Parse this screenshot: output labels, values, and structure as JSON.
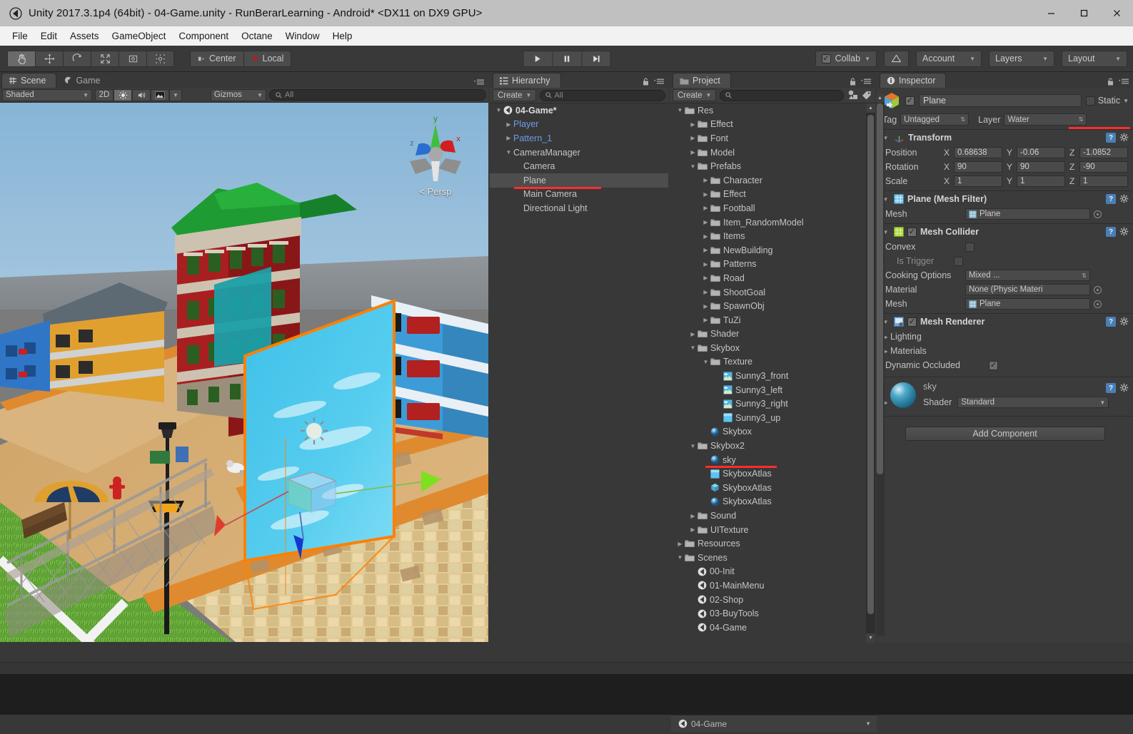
{
  "window": {
    "title": "Unity 2017.3.1p4 (64bit) - 04-Game.unity - RunBerarLearning - Android* <DX11 on DX9 GPU>",
    "app_icon": "unity-icon",
    "minimize_label": "—",
    "maximize_label": "□",
    "close_label": "✕"
  },
  "menubar": {
    "items": [
      "File",
      "Edit",
      "Assets",
      "GameObject",
      "Component",
      "Octane",
      "Window",
      "Help"
    ]
  },
  "toolbar": {
    "transform_tools": [
      {
        "name": "hand-tool",
        "glyph": "✋",
        "active": true
      },
      {
        "name": "move-tool",
        "glyph": "✥",
        "active": false
      },
      {
        "name": "rotate-tool",
        "glyph": "↻",
        "active": false
      },
      {
        "name": "scale-tool",
        "glyph": "⤡",
        "active": false
      },
      {
        "name": "rect-tool",
        "glyph": "▣",
        "active": false
      },
      {
        "name": "transform-tool",
        "glyph": "✣",
        "active": false
      }
    ],
    "pivot_mode": "Center",
    "pivot_rotation": "Local",
    "play": "▶",
    "pause": "‖",
    "step": "▶|",
    "collab": "Collab",
    "cloud_icon": "cloud-icon",
    "account": "Account",
    "layers": "Layers",
    "layout": "Layout"
  },
  "scene_panel": {
    "tabs": [
      {
        "label": "Scene",
        "icon": "scene-grid-icon",
        "active": true
      },
      {
        "label": "Game",
        "icon": "game-pacman-icon",
        "active": false
      }
    ],
    "draw_mode": "Shaded",
    "mode_2d": "2D",
    "lighting_icon": "sun-icon",
    "audio_icon": "speaker-icon",
    "fx_icon": "image-icon",
    "gizmos": "Gizmos",
    "search_placeholder": "All",
    "perspective_label": "Persp",
    "gizmo_axes": {
      "x": "x",
      "y": "y",
      "z": "z"
    },
    "selection_outline_color": "#ff8000"
  },
  "hierarchy": {
    "tab_label": "Hierarchy",
    "tab_icon": "hierarchy-icon",
    "create_label": "Create",
    "search_placeholder": "All",
    "rows": [
      {
        "label": "04-Game*",
        "depth": 0,
        "arrow": "down",
        "icon": "scene-unity-icon",
        "selected": false,
        "prefab": false,
        "bold": true
      },
      {
        "label": "Player",
        "depth": 1,
        "arrow": "right",
        "icon": "",
        "selected": false,
        "prefab": true
      },
      {
        "label": "Pattern_1",
        "depth": 1,
        "arrow": "right",
        "icon": "",
        "selected": false,
        "prefab": true
      },
      {
        "label": "CameraManager",
        "depth": 1,
        "arrow": "down",
        "icon": "",
        "selected": false,
        "prefab": false
      },
      {
        "label": "Camera",
        "depth": 2,
        "arrow": "none",
        "icon": "",
        "selected": false,
        "prefab": false
      },
      {
        "label": "Plane",
        "depth": 2,
        "arrow": "none",
        "icon": "",
        "selected": true,
        "prefab": false,
        "underline": true
      },
      {
        "label": "Main Camera",
        "depth": 2,
        "arrow": "none",
        "icon": "",
        "selected": false,
        "prefab": false
      },
      {
        "label": "Directional Light",
        "depth": 2,
        "arrow": "none",
        "icon": "",
        "selected": false,
        "prefab": false
      }
    ]
  },
  "project": {
    "tab_label": "Project",
    "tab_icon": "project-folder-icon",
    "create_label": "Create",
    "search_placeholder": "",
    "rows": [
      {
        "label": "Res",
        "depth": 0,
        "arrow": "down",
        "icon": "folder"
      },
      {
        "label": "Effect",
        "depth": 1,
        "arrow": "right",
        "icon": "folder"
      },
      {
        "label": "Font",
        "depth": 1,
        "arrow": "right",
        "icon": "folder"
      },
      {
        "label": "Model",
        "depth": 1,
        "arrow": "right",
        "icon": "folder"
      },
      {
        "label": "Prefabs",
        "depth": 1,
        "arrow": "down",
        "icon": "folder"
      },
      {
        "label": "Character",
        "depth": 2,
        "arrow": "right",
        "icon": "folder"
      },
      {
        "label": "Effect",
        "depth": 2,
        "arrow": "right",
        "icon": "folder"
      },
      {
        "label": "Football",
        "depth": 2,
        "arrow": "right",
        "icon": "folder"
      },
      {
        "label": "Item_RandomModel",
        "depth": 2,
        "arrow": "right",
        "icon": "folder"
      },
      {
        "label": "Items",
        "depth": 2,
        "arrow": "right",
        "icon": "folder"
      },
      {
        "label": "NewBuilding",
        "depth": 2,
        "arrow": "right",
        "icon": "folder"
      },
      {
        "label": "Patterns",
        "depth": 2,
        "arrow": "right",
        "icon": "folder"
      },
      {
        "label": "Road",
        "depth": 2,
        "arrow": "right",
        "icon": "folder"
      },
      {
        "label": "ShootGoal",
        "depth": 2,
        "arrow": "right",
        "icon": "folder"
      },
      {
        "label": "SpawnObj",
        "depth": 2,
        "arrow": "right",
        "icon": "folder"
      },
      {
        "label": "TuZi",
        "depth": 2,
        "arrow": "right",
        "icon": "folder"
      },
      {
        "label": "Shader",
        "depth": 1,
        "arrow": "right",
        "icon": "folder"
      },
      {
        "label": "Skybox",
        "depth": 1,
        "arrow": "down",
        "icon": "folder"
      },
      {
        "label": "Texture",
        "depth": 2,
        "arrow": "down",
        "icon": "folder"
      },
      {
        "label": "Sunny3_front",
        "depth": 3,
        "arrow": "none",
        "icon": "texture-sky"
      },
      {
        "label": "Sunny3_left",
        "depth": 3,
        "arrow": "none",
        "icon": "texture-sky"
      },
      {
        "label": "Sunny3_right",
        "depth": 3,
        "arrow": "none",
        "icon": "texture-sky"
      },
      {
        "label": "Sunny3_up",
        "depth": 3,
        "arrow": "none",
        "icon": "texture-plain"
      },
      {
        "label": "Skybox",
        "depth": 2,
        "arrow": "none",
        "icon": "material-sphere"
      },
      {
        "label": "Skybox2",
        "depth": 1,
        "arrow": "down",
        "icon": "folder"
      },
      {
        "label": "sky",
        "depth": 2,
        "arrow": "none",
        "icon": "material-sphere",
        "underline": true
      },
      {
        "label": "SkyboxAtlas",
        "depth": 2,
        "arrow": "none",
        "icon": "texture-plain"
      },
      {
        "label": "SkyboxAtlas",
        "depth": 2,
        "arrow": "none",
        "icon": "prefab-cube"
      },
      {
        "label": "SkyboxAtlas",
        "depth": 2,
        "arrow": "none",
        "icon": "material-sphere"
      },
      {
        "label": "Sound",
        "depth": 1,
        "arrow": "right",
        "icon": "folder"
      },
      {
        "label": "UITexture",
        "depth": 1,
        "arrow": "right",
        "icon": "folder"
      },
      {
        "label": "Resources",
        "depth": 0,
        "arrow": "right",
        "icon": "folder"
      },
      {
        "label": "Scenes",
        "depth": 0,
        "arrow": "down",
        "icon": "folder"
      },
      {
        "label": "00-Init",
        "depth": 1,
        "arrow": "none",
        "icon": "scene-unity-icon"
      },
      {
        "label": "01-MainMenu",
        "depth": 1,
        "arrow": "none",
        "icon": "scene-unity-icon"
      },
      {
        "label": "02-Shop",
        "depth": 1,
        "arrow": "none",
        "icon": "scene-unity-icon"
      },
      {
        "label": "03-BuyTools",
        "depth": 1,
        "arrow": "none",
        "icon": "scene-unity-icon"
      },
      {
        "label": "04-Game",
        "depth": 1,
        "arrow": "none",
        "icon": "scene-unity-icon"
      }
    ],
    "footer_item": "04-Game"
  },
  "inspector": {
    "tab_label": "Inspector",
    "tab_icon": "info-icon",
    "object_name": "Plane",
    "object_enabled": true,
    "object_icon": "prefab-cube-icon",
    "static_label": "Static",
    "static_checked": false,
    "tag_label": "Tag",
    "tag_value": "Untagged",
    "layer_label": "Layer",
    "layer_value": "Water",
    "layer_highlighted": true,
    "components": [
      {
        "title": "Transform",
        "icon": "transform-axis-icon",
        "has_checkbox": false,
        "expanded": true,
        "vector_rows": [
          {
            "label": "Position",
            "x": "0.68638",
            "y": "-0.06",
            "z": "-1.0852"
          },
          {
            "label": "Rotation",
            "x": "90",
            "y": "90",
            "z": "-90"
          },
          {
            "label": "Scale",
            "x": "1",
            "y": "1",
            "z": "1"
          }
        ]
      },
      {
        "title": "Plane (Mesh Filter)",
        "icon": "mesh-filter-icon",
        "has_checkbox": false,
        "expanded": true,
        "object_rows": [
          {
            "label": "Mesh",
            "value": "Plane",
            "value_icon": "mesh-icon"
          }
        ]
      },
      {
        "title": "Mesh Collider",
        "icon": "mesh-collider-icon",
        "has_checkbox": true,
        "checked": true,
        "expanded": true,
        "bool_rows": [
          {
            "label": "Convex",
            "checked": false,
            "dim": false
          },
          {
            "label": "Is Trigger",
            "checked": false,
            "dim": true
          }
        ],
        "dropdown_rows": [
          {
            "label": "Cooking Options",
            "value": "Mixed ..."
          }
        ],
        "object_rows": [
          {
            "label": "Material",
            "value": "None (Physic Materi",
            "value_icon": ""
          },
          {
            "label": "Mesh",
            "value": "Plane",
            "value_icon": "mesh-icon"
          }
        ]
      },
      {
        "title": "Mesh Renderer",
        "icon": "mesh-renderer-icon",
        "has_checkbox": true,
        "checked": true,
        "expanded": true,
        "foldouts": [
          "Lighting",
          "Materials"
        ],
        "bool_rows": [
          {
            "label": "Dynamic Occluded",
            "checked": true,
            "dim": false
          }
        ]
      }
    ],
    "material": {
      "name": "sky",
      "shader_label": "Shader",
      "shader_value": "Standard",
      "preview_icon": "material-sphere-preview"
    },
    "add_component_label": "Add Component"
  }
}
